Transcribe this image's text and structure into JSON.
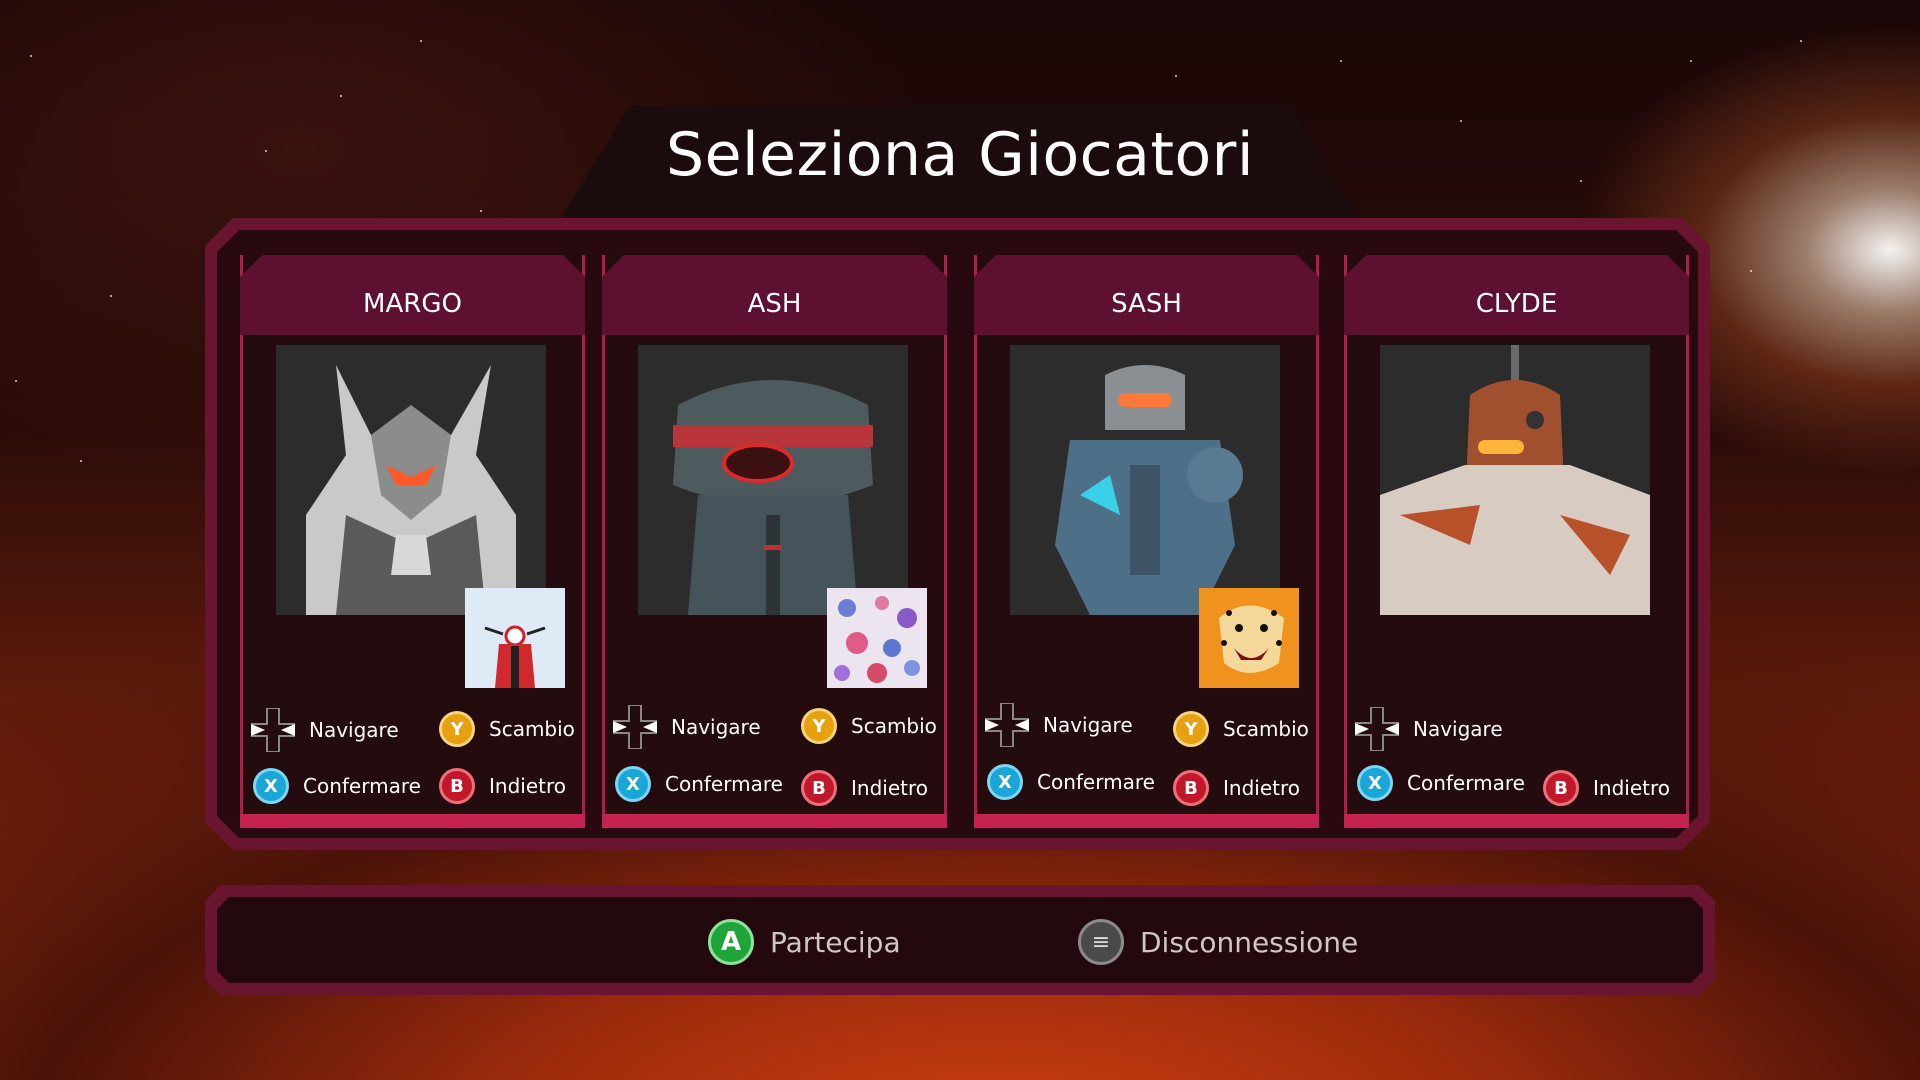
{
  "title": "Seleziona Giocatori",
  "colors": {
    "accent": "#b21c49",
    "frame": "#6a1530",
    "x_button": "#1aa6d8",
    "y_button": "#e6a010",
    "b_button": "#c01828",
    "a_button": "#1fa437"
  },
  "players": [
    {
      "name": "MARGO",
      "avatar": "scooter-badge",
      "hints": {
        "navigate": "Navigare",
        "swap": "Scambio",
        "confirm": "Confermare",
        "back": "Indietro"
      }
    },
    {
      "name": "ASH",
      "avatar": "flowers-badge",
      "hints": {
        "navigate": "Navigare",
        "swap": "Scambio",
        "confirm": "Confermare",
        "back": "Indietro"
      }
    },
    {
      "name": "SASH",
      "avatar": "cheetah-badge",
      "hints": {
        "navigate": "Navigare",
        "swap": "Scambio",
        "confirm": "Confermare",
        "back": "Indietro"
      }
    },
    {
      "name": "CLYDE",
      "avatar": null,
      "hints": {
        "navigate": "Navigare",
        "confirm": "Confermare",
        "back": "Indietro"
      }
    }
  ],
  "buttons": {
    "x": "X",
    "y": "Y",
    "b": "B",
    "a": "A",
    "menu": "≡"
  },
  "bottom_bar": {
    "join": "Partecipa",
    "disconnect": "Disconnessione"
  }
}
